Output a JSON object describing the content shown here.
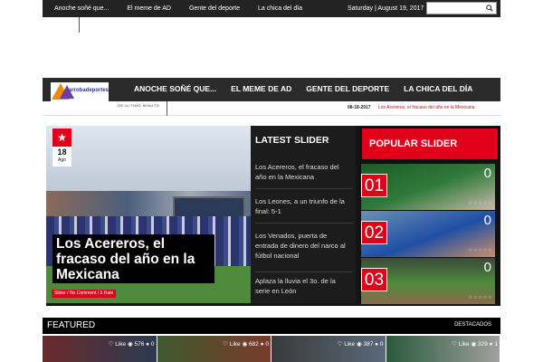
{
  "topbar": {
    "nav": [
      "Anoche soñé que...",
      "El meme de AD",
      "Gente del deporte",
      "La chica del día"
    ],
    "date": "Saturday | August 19, 2017"
  },
  "header": {
    "logo_text": "arrobadeportes",
    "nav": [
      "ANOCHE SOÑÉ QUE...",
      "EL MEME DE AD",
      "GENTE DEL DEPORTE",
      "LA CHICA DEL DÍA"
    ]
  },
  "ticker": {
    "label": "DE ULTIMO MINUTO",
    "date": "08-18-2017",
    "text": "Los Acereros, el fracaso del año en la Mexicana"
  },
  "hero": {
    "day": "18",
    "month": "Ago",
    "title": "Los Acereros, el fracaso del año en la Mexicana",
    "meta": "Slider / No Comment / 5 Rate"
  },
  "latest": {
    "heading": "LATEST SLIDER",
    "items": [
      "Los Acereros, el fracaso del año en la Mexicana",
      "Los Leones, a un triunfo de la final: 5-1",
      "Los Venados, puerta de entrada de dinero del narco al fútbol nacional",
      "Aplaza la lluvia el 3o. de la serie en León"
    ]
  },
  "popular": {
    "heading": "POPULAR SLIDER",
    "rows": [
      {
        "num": "01",
        "count": "0",
        "stars": "☆☆☆☆☆"
      },
      {
        "num": "02",
        "count": "0",
        "stars": "☆☆☆☆☆"
      },
      {
        "num": "03",
        "count": "0",
        "stars": "☆☆☆☆☆"
      }
    ]
  },
  "featured": {
    "title": "FEATURED",
    "right_label": "DESTACADOS",
    "cards": [
      {
        "like": "♡ Like",
        "views": "576",
        "comments": "0"
      },
      {
        "like": "♡ Like",
        "views": "682",
        "comments": "0"
      },
      {
        "like": "♡ Like",
        "views": "387",
        "comments": "0"
      },
      {
        "like": "♡ Like",
        "views": "329",
        "comments": "1"
      }
    ]
  },
  "colors": {
    "accent": "#e0001a",
    "topbar": "#232323",
    "nav": "#2b2b2b"
  }
}
